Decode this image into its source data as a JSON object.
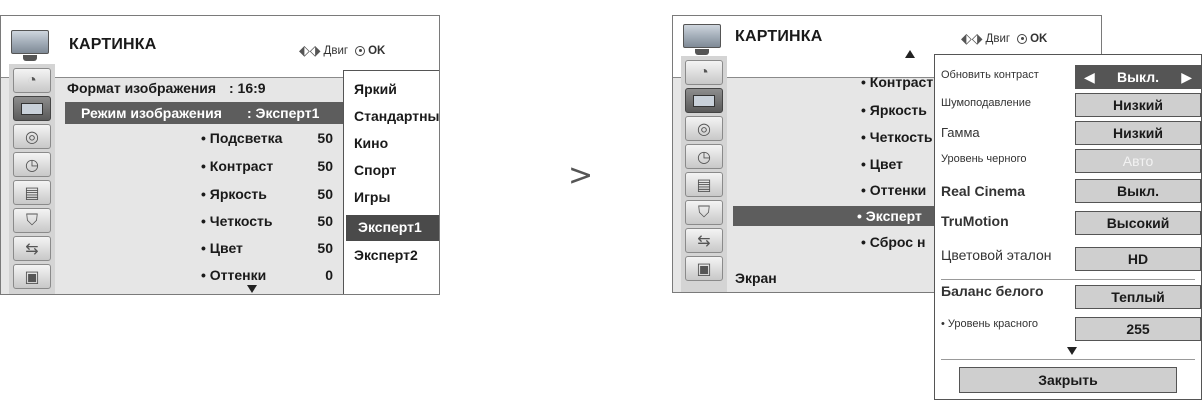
{
  "left": {
    "title": "КАРТИНКА",
    "nav_move": "Двиг",
    "nav_ok": "OK",
    "items": [
      {
        "label": "Формат изображения",
        "value": ": 16:9"
      },
      {
        "label": "Режим изображения",
        "value": ": Эксперт1"
      },
      {
        "label": "• Подсветка",
        "value": "50"
      },
      {
        "label": "• Контраст",
        "value": "50"
      },
      {
        "label": "• Яркость",
        "value": "50"
      },
      {
        "label": "• Четкость",
        "value": "50"
      },
      {
        "label": "• Цвет",
        "value": "50"
      },
      {
        "label": "• Оттенки",
        "value": "0"
      }
    ],
    "modes": [
      "Яркий",
      "Стандартный",
      "Кино",
      "Спорт",
      "Игры",
      "Эксперт1",
      "Эксперт2"
    ],
    "selected_mode": "Эксперт1"
  },
  "transition_symbol": ">",
  "right": {
    "title": "КАРТИНКА",
    "nav_move": "Двиг",
    "nav_ok": "OK",
    "items": [
      "• Контраст",
      "• Яркость",
      "• Четкость",
      "• Цвет",
      "• Оттенки",
      "• Эксперт",
      "• Сброс н"
    ],
    "screen_label": "Экран",
    "popup": {
      "rows": [
        {
          "label": "Обновить контраст",
          "value": "Выкл."
        },
        {
          "label": "Шумоподавление",
          "value": "Низкий"
        },
        {
          "label": "Гамма",
          "value": "Низкий"
        },
        {
          "label": "Уровень черного",
          "value": "Авто"
        },
        {
          "label": "Real Cinema",
          "value": "Выкл."
        },
        {
          "label": "TruMotion",
          "value": "Высокий"
        },
        {
          "label": "Цветовой эталон",
          "value": "HD"
        },
        {
          "label": "Баланс белого",
          "value": "Теплый"
        },
        {
          "label": "• Уровень красного",
          "value": "255"
        }
      ],
      "close_label": "Закрыть"
    }
  }
}
